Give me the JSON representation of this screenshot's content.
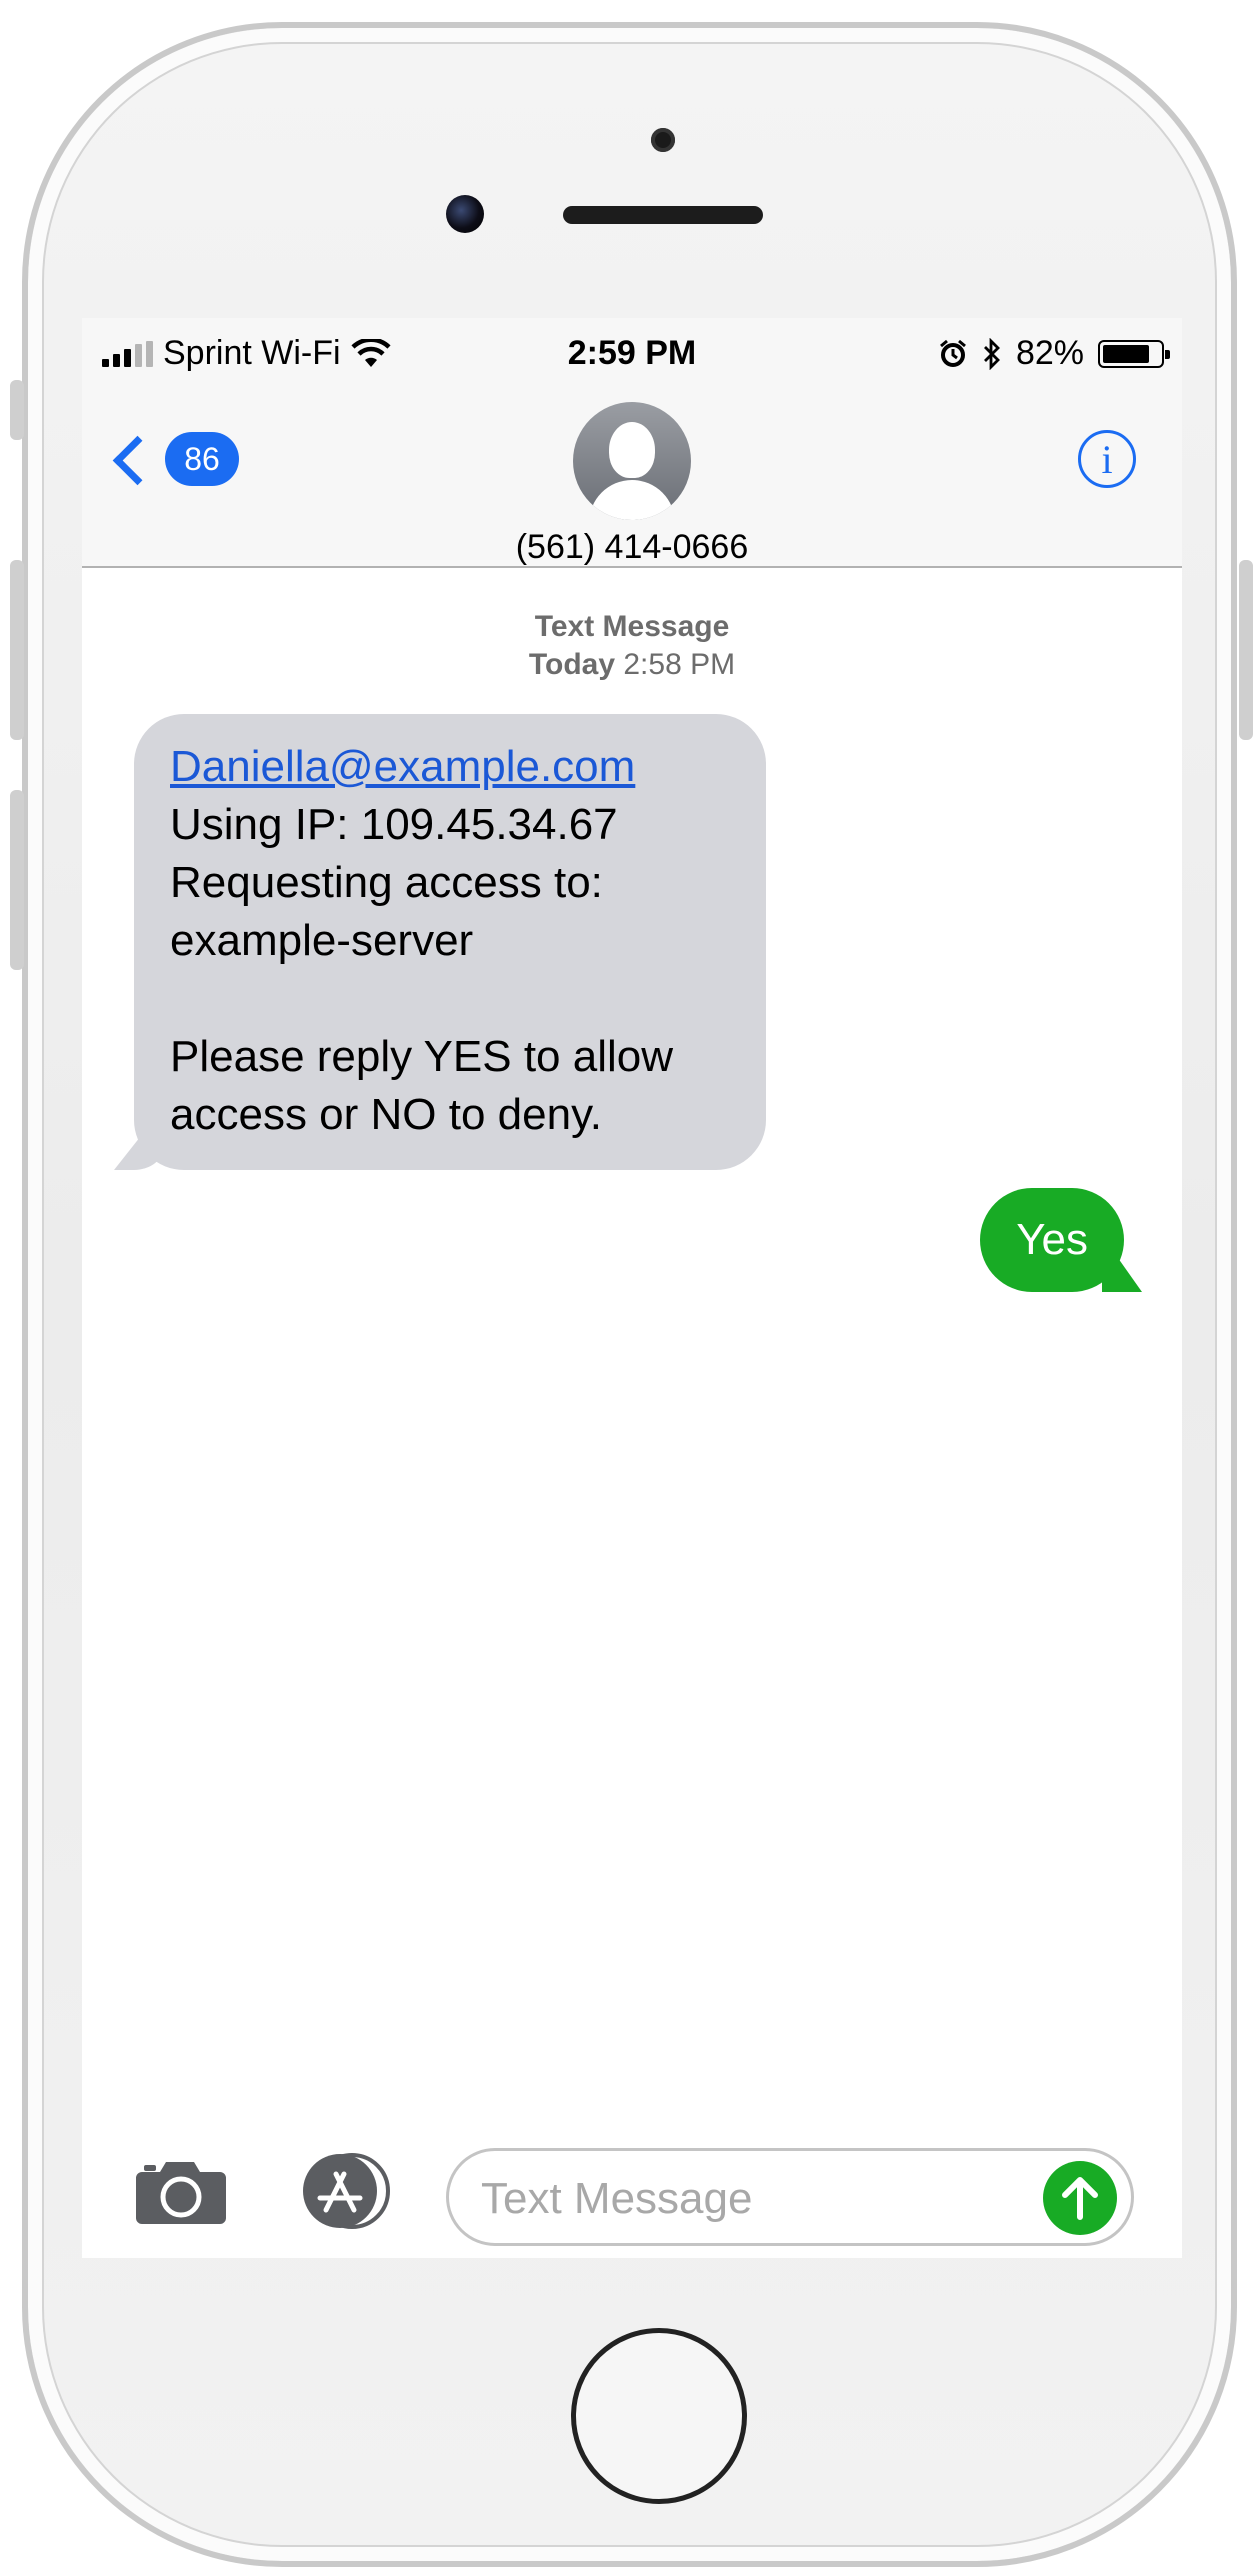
{
  "status_bar": {
    "carrier": "Sprint Wi-Fi",
    "time": "2:59 PM",
    "battery": "82%"
  },
  "nav": {
    "back_count": "86",
    "contact": "(561) 414-0666"
  },
  "conversation": {
    "stamp_label": "Text Message",
    "stamp_day": "Today",
    "stamp_time": "2:58 PM",
    "incoming": {
      "email": "Daniella@example.com",
      "line_ip": "Using IP: 109.45.34.67",
      "line_request": "Requesting access to:",
      "line_server": "example-server",
      "line_reply_1": "Please reply YES to allow",
      "line_reply_2": "access or NO to deny."
    },
    "outgoing": "Yes"
  },
  "input": {
    "placeholder": "Text Message"
  },
  "colors": {
    "accent": "#1b6cf2",
    "sent_bubble": "#18ab25",
    "received_bubble": "#d5d6db"
  },
  "icons": [
    "signal-bars-icon",
    "wifi-icon",
    "alarm-icon",
    "bluetooth-icon",
    "battery-icon",
    "back-chevron-icon",
    "avatar-icon",
    "info-icon",
    "camera-icon",
    "app-store-icon",
    "send-arrow-icon"
  ]
}
